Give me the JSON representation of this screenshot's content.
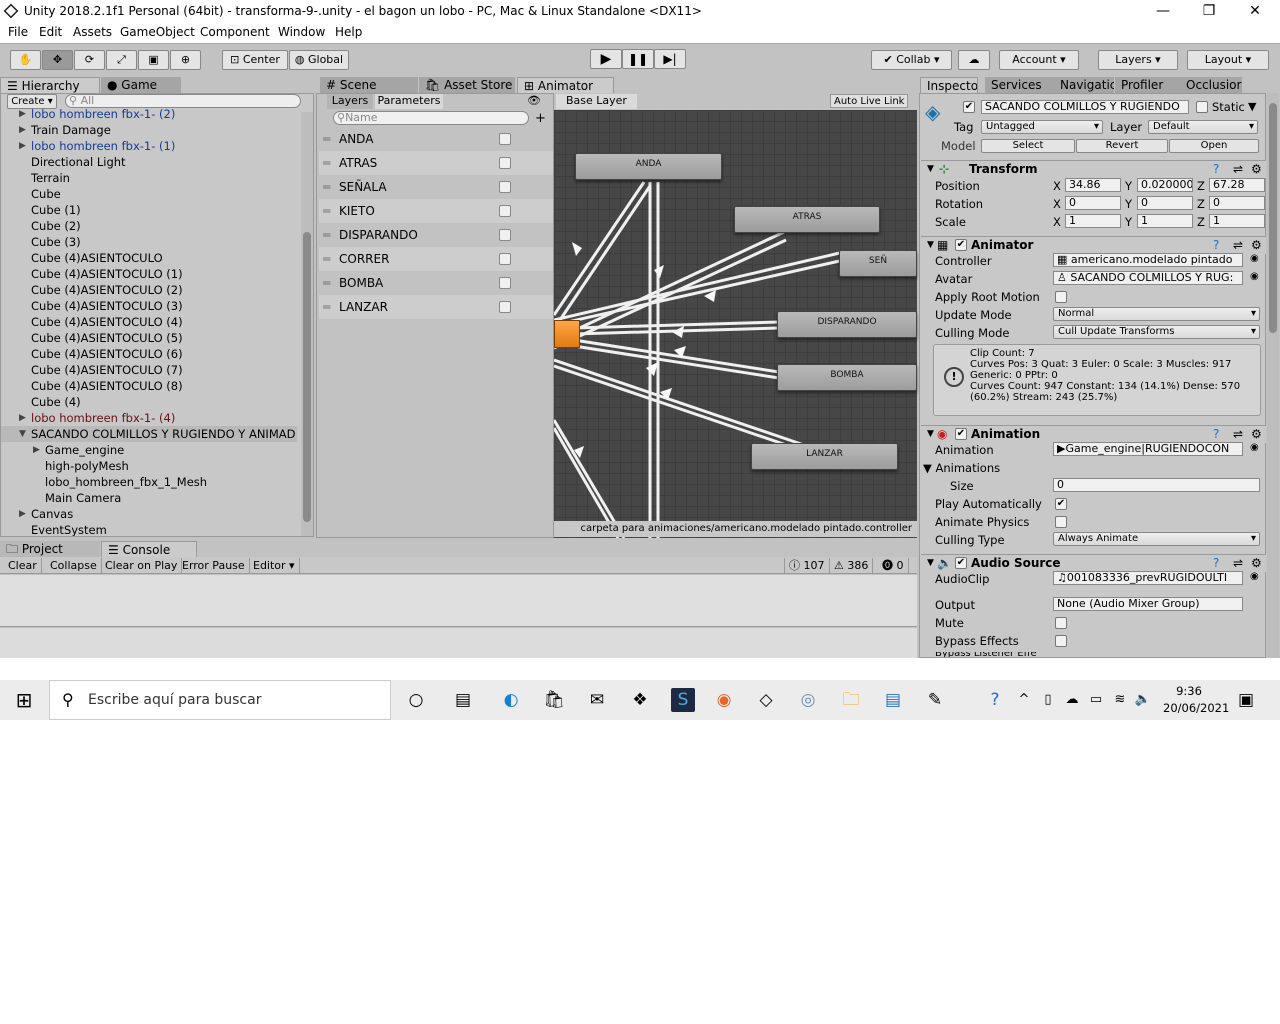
{
  "window": {
    "title": "Unity 2018.2.1f1 Personal (64bit) - transforma-9-.unity - el bagon un lobo - PC, Mac & Linux Standalone <DX11>",
    "minimize": "—",
    "maximize": "❐",
    "close": "✕"
  },
  "menu": [
    "File",
    "Edit",
    "Assets",
    "GameObject",
    "Component",
    "Window",
    "Help"
  ],
  "toolbar": {
    "pivot": "Center",
    "space": "Global",
    "collab": "Collab ▾",
    "account": "Account",
    "layers": "Layers",
    "layout": "Layout"
  },
  "left_tabs": {
    "hierarchy": "Hierarchy",
    "game": "Game",
    "create": "Create ▾",
    "search_placeholder": "All"
  },
  "hierarchy": [
    {
      "label": "lobo hombreen fbx-1- (2)",
      "style": "blue",
      "indent": 0,
      "arrow": "▶"
    },
    {
      "label": "Train Damage",
      "style": "normal",
      "indent": 0,
      "arrow": "▶"
    },
    {
      "label": "lobo hombreen fbx-1- (1)",
      "style": "blue",
      "indent": 0,
      "arrow": "▶"
    },
    {
      "label": "Directional Light",
      "style": "normal",
      "indent": 0,
      "arrow": ""
    },
    {
      "label": "Terrain",
      "style": "normal",
      "indent": 0,
      "arrow": ""
    },
    {
      "label": "Cube",
      "style": "normal",
      "indent": 0,
      "arrow": ""
    },
    {
      "label": "Cube (1)",
      "style": "normal",
      "indent": 0,
      "arrow": ""
    },
    {
      "label": "Cube (2)",
      "style": "normal",
      "indent": 0,
      "arrow": ""
    },
    {
      "label": "Cube (3)",
      "style": "normal",
      "indent": 0,
      "arrow": ""
    },
    {
      "label": "Cube (4)ASIENTOCULO",
      "style": "normal",
      "indent": 0,
      "arrow": ""
    },
    {
      "label": "Cube (4)ASIENTOCULO (1)",
      "style": "normal",
      "indent": 0,
      "arrow": ""
    },
    {
      "label": "Cube (4)ASIENTOCULO (2)",
      "style": "normal",
      "indent": 0,
      "arrow": ""
    },
    {
      "label": "Cube (4)ASIENTOCULO (3)",
      "style": "normal",
      "indent": 0,
      "arrow": ""
    },
    {
      "label": "Cube (4)ASIENTOCULO (4)",
      "style": "normal",
      "indent": 0,
      "arrow": ""
    },
    {
      "label": "Cube (4)ASIENTOCULO (5)",
      "style": "normal",
      "indent": 0,
      "arrow": ""
    },
    {
      "label": "Cube (4)ASIENTOCULO (6)",
      "style": "normal",
      "indent": 0,
      "arrow": ""
    },
    {
      "label": "Cube (4)ASIENTOCULO (7)",
      "style": "normal",
      "indent": 0,
      "arrow": ""
    },
    {
      "label": "Cube (4)ASIENTOCULO (8)",
      "style": "normal",
      "indent": 0,
      "arrow": ""
    },
    {
      "label": "Cube (4)",
      "style": "normal",
      "indent": 0,
      "arrow": ""
    },
    {
      "label": "lobo hombreen fbx-1- (4)",
      "style": "red",
      "indent": 0,
      "arrow": "▶"
    },
    {
      "label": "SACANDO COLMILLOS Y RUGIENDO Y ANIMAD",
      "style": "sel",
      "indent": 0,
      "arrow": "▼"
    },
    {
      "label": "Game_engine",
      "style": "normal",
      "indent": 1,
      "arrow": "▶"
    },
    {
      "label": "high-polyMesh",
      "style": "normal",
      "indent": 1,
      "arrow": ""
    },
    {
      "label": "lobo_hombreen_fbx_1_Mesh",
      "style": "normal",
      "indent": 1,
      "arrow": ""
    },
    {
      "label": "Main Camera",
      "style": "normal",
      "indent": 1,
      "arrow": ""
    },
    {
      "label": "Canvas",
      "style": "normal",
      "indent": 0,
      "arrow": "▶"
    },
    {
      "label": "EventSystem",
      "style": "normal",
      "indent": 0,
      "arrow": ""
    }
  ],
  "center_tabs": {
    "scene": "Scene",
    "asset_store": "Asset Store",
    "animator": "Animator"
  },
  "animator": {
    "layers_tab": "Layers",
    "params_tab": "Parameters",
    "name_placeholder": "Name",
    "base_layer": "Base Layer",
    "auto_live": "Auto Live Link",
    "path": "carpeta para animaciones/americano.modelado pintado.controller",
    "parameters": [
      "ANDA",
      "ATRAS",
      "SEÑALA",
      "KIETO",
      "DISPARANDO",
      "CORRER",
      "BOMBA",
      "LANZAR"
    ],
    "states": [
      "ANDA",
      "ATRAS",
      "SEÑ",
      "DISPARANDO",
      "BOMBA",
      "LANZAR"
    ]
  },
  "bottom": {
    "project": "Project",
    "console": "Console",
    "clear": "Clear",
    "collapse": "Collapse",
    "clear_on_play": "Clear on Play",
    "error_pause": "Error Pause",
    "editor": "Editor ▾",
    "logs": "107",
    "warnings": "386",
    "errors": "0"
  },
  "inspector": {
    "tabs": [
      "Inspector",
      "Services",
      "Navigatic",
      "Profiler",
      "Occlusior"
    ],
    "object_name": "SACANDO COLMILLOS Y RUGIENDO",
    "static_label": "Static",
    "tag_label": "Tag",
    "tag_value": "Untagged",
    "layer_label": "Layer",
    "layer_value": "Default",
    "model_label": "Model",
    "select": "Select",
    "revert": "Revert",
    "open": "Open",
    "transform": {
      "title": "Transform",
      "position": "Position",
      "rotation": "Rotation",
      "scale": "Scale",
      "pos": [
        "34.86",
        "0.020000",
        "67.28"
      ],
      "rot": [
        "0",
        "0",
        "0"
      ],
      "scl": [
        "1",
        "1",
        "1"
      ]
    },
    "animator": {
      "title": "Animator",
      "controller_label": "Controller",
      "controller": "americano.modelado pintado",
      "avatar_label": "Avatar",
      "avatar": "SACANDO COLMILLOS Y RUG:",
      "root_motion": "Apply Root Motion",
      "update_label": "Update Mode",
      "update": "Normal",
      "culling_label": "Culling Mode",
      "culling": "Cull Update Transforms",
      "info": [
        "Clip Count: 7",
        "Curves Pos: 3 Quat: 3 Euler: 0 Scale: 3 Muscles: 917",
        "Generic: 0 PPtr: 0",
        "Curves Count: 947 Constant: 134 (14.1%) Dense: 570",
        "(60.2%) Stream: 243 (25.7%)"
      ]
    },
    "animation": {
      "title": "Animation",
      "anim_label": "Animation",
      "anim": "Game_engine|RUGIENDOCON",
      "anims_label": "Animations",
      "size_label": "Size",
      "size": "0",
      "play_auto": "Play Automatically",
      "physics": "Animate Physics",
      "culling_label": "Culling Type",
      "culling": "Always Animate"
    },
    "audio": {
      "title": "Audio Source",
      "clip_label": "AudioClip",
      "clip": "001083336_prevRUGIDOULTI",
      "output_label": "Output",
      "output": "None (Audio Mixer Group)",
      "mute": "Mute",
      "bypass": "Bypass Effects",
      "bypass2": "Bypass Listener Effe"
    }
  },
  "taskbar": {
    "search": "Escribe aquí para buscar",
    "time": "9:36",
    "date": "20/06/2021"
  }
}
